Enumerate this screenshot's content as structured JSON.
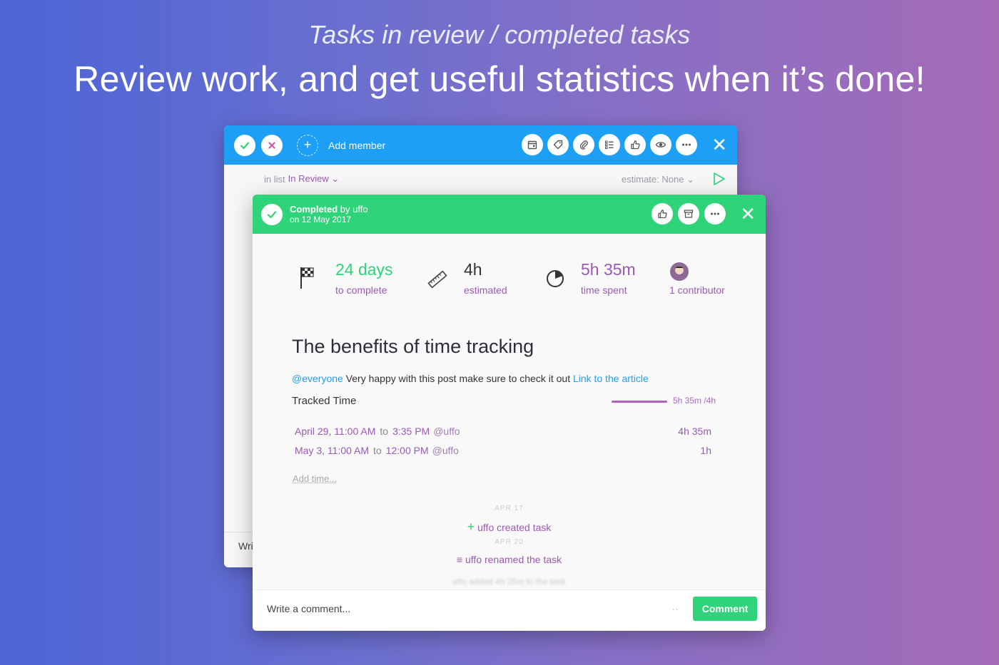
{
  "hero": {
    "subtitle": "Tasks in review / completed tasks",
    "title": "Review work, and get useful statistics when it’s done!"
  },
  "back_card": {
    "add_member_label": "Add member",
    "list_prefix": "in list",
    "list_value": "In Review",
    "estimate_label": "estimate:",
    "estimate_value": "None",
    "comment_stub": "Wri",
    "toolbar_icons": [
      "calendar-icon",
      "tag-icon",
      "paperclip-icon",
      "checklist-icon",
      "thumbs-up-icon",
      "eye-icon",
      "more-icon"
    ]
  },
  "front_card": {
    "completed_label": "Completed",
    "completed_by": "by uffo",
    "completed_date": "on 12 May 2017",
    "toolbar_icons": [
      "thumbs-up-icon",
      "archive-icon",
      "more-icon"
    ],
    "stats": {
      "days_value": "24 days",
      "days_label": "to complete",
      "estimate_value": "4h",
      "estimate_label": "estimated",
      "spent_value": "5h 35m",
      "spent_label": "time spent",
      "contributors_label": "1 contributor"
    },
    "task_title": "The benefits of time tracking",
    "description": {
      "mention": "@everyone",
      "text": "Very happy with this post make sure to check it out",
      "link": "Link to the article"
    },
    "tracked_time": {
      "label": "Tracked Time",
      "progress_text": "5h 35m /4h",
      "progress_fraction": 1.0,
      "entries": [
        {
          "start": "April 29, 11:00 AM",
          "to": "to",
          "end": "3:35 PM",
          "user": "@uffo",
          "duration": "4h 35m"
        },
        {
          "start": "May 3, 11:00 AM",
          "to": "to",
          "end": "12:00 PM",
          "user": "@uffo",
          "duration": "1h"
        }
      ],
      "add_time": "Add time..."
    },
    "activity": [
      {
        "date": "APR 17",
        "text": "uffo created task"
      },
      {
        "date": "APR 20",
        "text": "uffo renamed the task"
      }
    ],
    "activity_faint": "uffo added 4h 35m to the task",
    "comment_placeholder": "Write a comment...",
    "comment_button": "Comment"
  },
  "colors": {
    "accent_blue": "#1d9ff6",
    "accent_green": "#2fd37a",
    "accent_purple": "#9b58b5"
  }
}
